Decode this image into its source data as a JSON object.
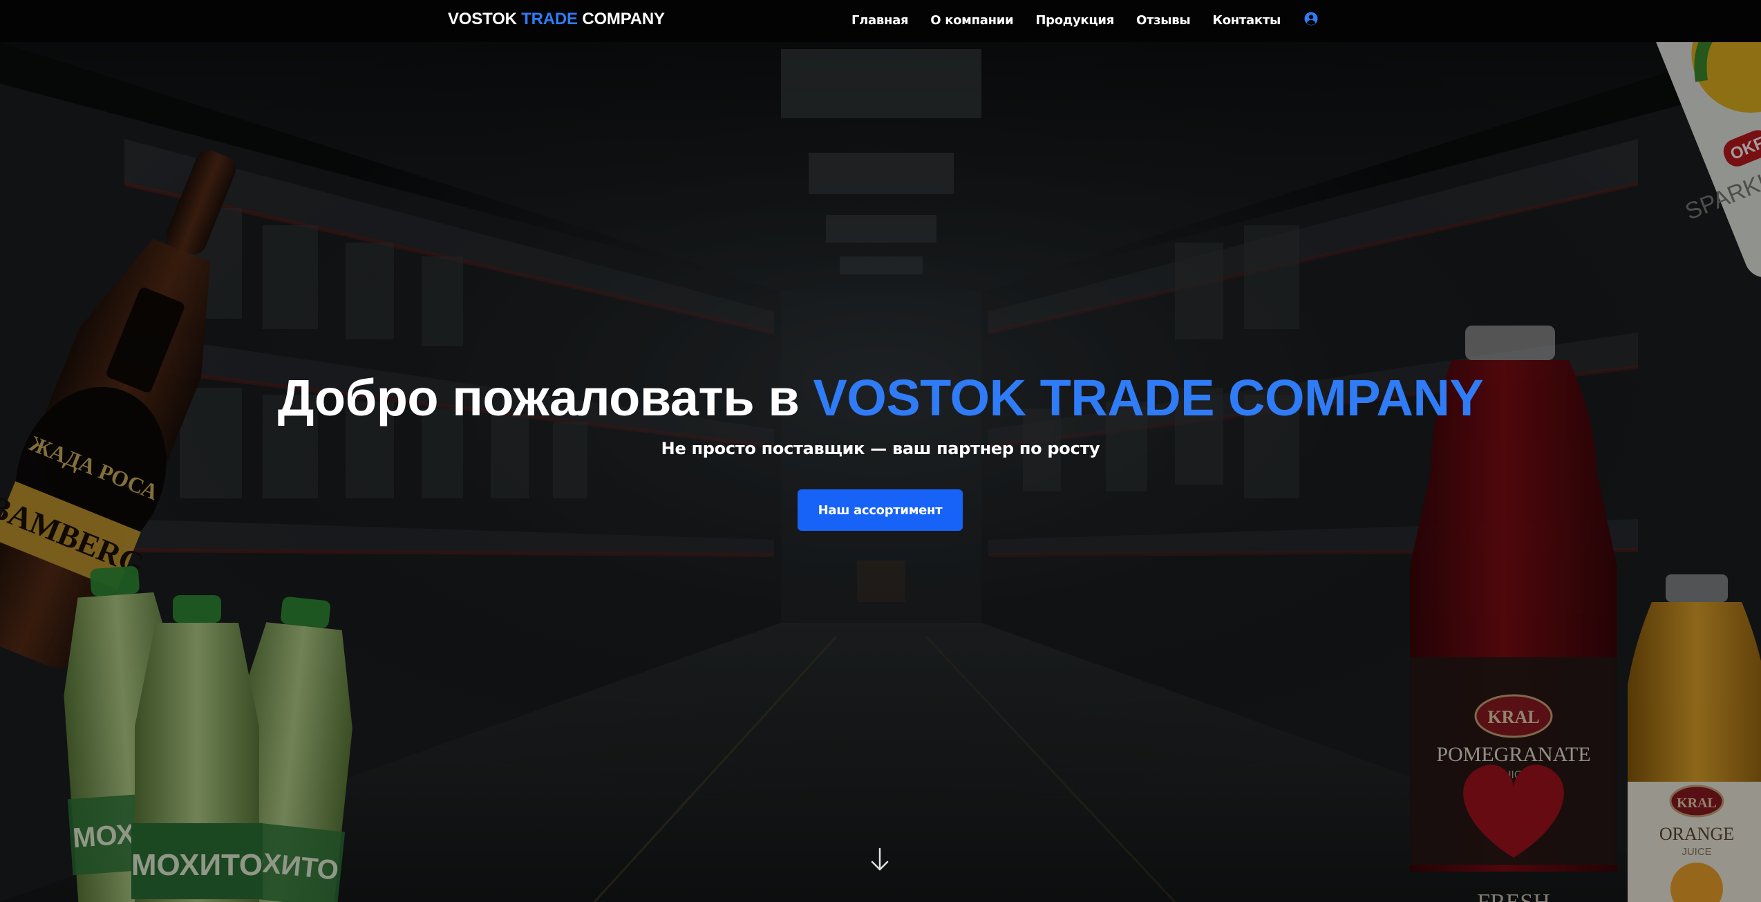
{
  "brand": {
    "part1": "VOSTOK ",
    "accent": "TRADE",
    "part2": " COMPANY"
  },
  "nav": {
    "items": [
      {
        "label": "Главная"
      },
      {
        "label": "О компании"
      },
      {
        "label": "Продукция"
      },
      {
        "label": "Отзывы"
      },
      {
        "label": "Контакты"
      }
    ],
    "account_icon": "user-circle-icon"
  },
  "hero": {
    "title_prefix": "Добро пожаловать в ",
    "title_accent": "VOSTOK TRADE COMPANY",
    "subtitle": "Не просто поставщик — ваш партнер по росту",
    "cta_label": "Наш ассортимент",
    "scroll_icon": "arrow-down-icon"
  },
  "products": {
    "beer_label": "ЖАДА РОСА",
    "beer_sublabel": "BAMBERG",
    "mojito_label": "МОХИТО",
    "okf_brand": "OKF",
    "okf_label": "SPARKLING YUZU",
    "pomegranate_brand": "KRAL",
    "pomegranate_label": "POMEGRANATE",
    "pomegranate_sub": "JUICE",
    "pomegranate_fresh": "FRESH",
    "orange_brand": "KRAL",
    "orange_label": "ORANGE",
    "orange_sub": "JUICE"
  },
  "colors": {
    "accent": "#2f7cf6",
    "button": "#1863f7",
    "navbar": "#030303"
  }
}
